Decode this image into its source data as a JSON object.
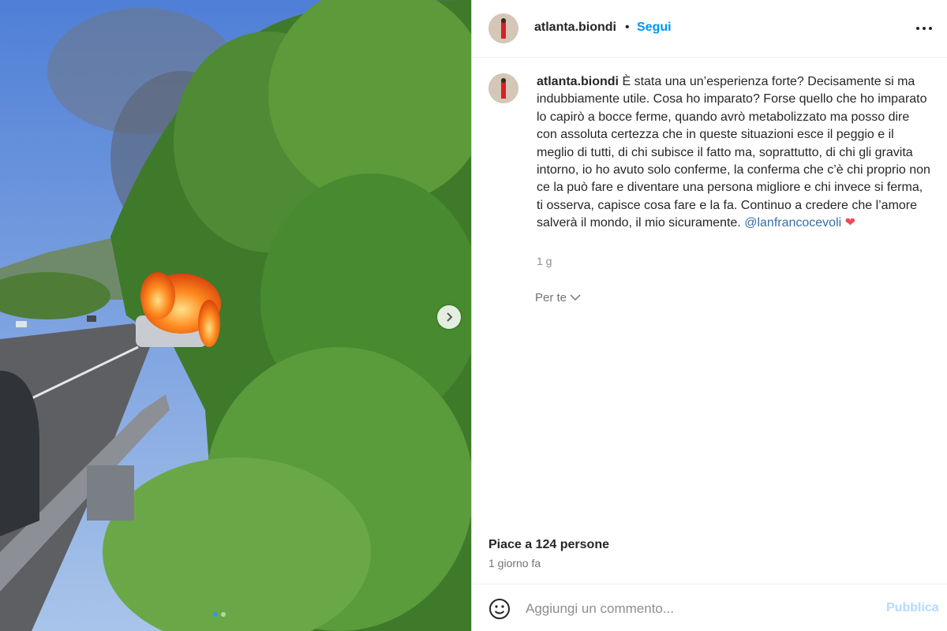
{
  "post": {
    "photo_icon": "post-photo",
    "carousel_dots": [
      true,
      false
    ]
  },
  "header": {
    "username": "atlanta.biondi",
    "separator": "•",
    "follow_label": "Segui",
    "more_icon": "more-horizontal-icon"
  },
  "caption": {
    "username": "atlanta.biondi",
    "text": "È stata una un’esperienza forte? Decisamente si ma indubbiamente utile. Cosa ho imparato? Forse quello che ho imparato lo capirò a bocce ferme, quando avrò metabolizzato ma posso dire con assoluta certezza che in queste situazioni esce il peggio e il meglio di tutti, di chi subisce il fatto ma, soprattutto, di chi gli gravita intorno, io ho avuto solo conferme, la conferma che c’è chi proprio non ce la può fare e diventare una persona migliore e chi invece si ferma, ti osserva, capisce cosa fare e la fa. Continuo a credere che l’amore salverà il mondo, il mio sicuramente.",
    "mention": "@lanfrancocevoli",
    "heart": "❤",
    "age": "1 g",
    "translate_label": "Per te"
  },
  "stats": {
    "likes_text": "Piace a 124 persone",
    "date_text": "1 giorno fa"
  },
  "comment": {
    "placeholder": "Aggiungi un commento...",
    "publish_label": "Pubblica",
    "emoji_icon": "emoji-icon"
  },
  "colors": {
    "link": "#0095f6",
    "mention": "#3a6ea5",
    "publish_disabled": "#b3dbff"
  }
}
